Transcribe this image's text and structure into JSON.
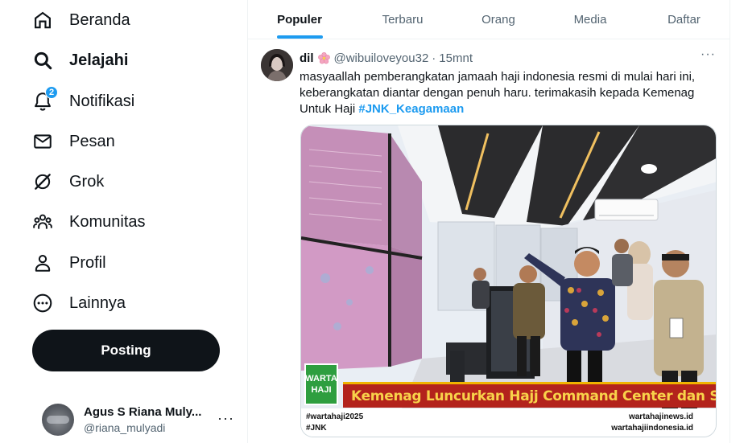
{
  "sidebar": {
    "items": [
      {
        "label": "Beranda",
        "icon": "home-icon"
      },
      {
        "label": "Jelajahi",
        "icon": "search-icon"
      },
      {
        "label": "Notifikasi",
        "icon": "bell-icon",
        "badge": "2"
      },
      {
        "label": "Pesan",
        "icon": "mail-icon"
      },
      {
        "label": "Grok",
        "icon": "grok-icon"
      },
      {
        "label": "Komunitas",
        "icon": "communities-icon"
      },
      {
        "label": "Profil",
        "icon": "profile-icon"
      },
      {
        "label": "Lainnya",
        "icon": "more-circle-icon"
      }
    ],
    "active_item": "Jelajahi",
    "post_label": "Posting"
  },
  "account": {
    "name": "Agus S Riana Muly...",
    "handle": "@riana_mulyadi",
    "more": "···"
  },
  "tabs": [
    {
      "label": "Populer",
      "active": true
    },
    {
      "label": "Terbaru",
      "active": false
    },
    {
      "label": "Orang",
      "active": false
    },
    {
      "label": "Media",
      "active": false
    },
    {
      "label": "Daftar",
      "active": false
    }
  ],
  "tweet": {
    "display_name": "dil",
    "emoji": "cherry-blossom-icon",
    "handle": "@wibuiloveyou32",
    "separator": "·",
    "time": "15mnt",
    "more": "···",
    "text": "masyaallah pemberangkatan jamaah haji indonesia resmi di mulai hari ini, keberangkatan diantar dengan penuh haru. terimakasih kepada Kemenag Untuk Haji ",
    "hashtag": "#JNK_Keagamaan",
    "image": {
      "logo_line1": "WARTA",
      "logo_line2": "HAJI",
      "headline": "Kemenag Luncurkan Hajj Command Center dan Satu Haji",
      "tag1": "#wartahaji2025",
      "tag2": "#JNK",
      "site1": "wartahajinews.id",
      "site2": "wartahajiindonesia.id"
    }
  },
  "colors": {
    "accent": "#1d9bf0",
    "text_primary": "#0f1419",
    "text_secondary": "#536471",
    "post_button": "#0f1419",
    "banner_red": "#b3231c",
    "banner_text": "#f8d24a",
    "logo_green": "#2e9e3f"
  }
}
